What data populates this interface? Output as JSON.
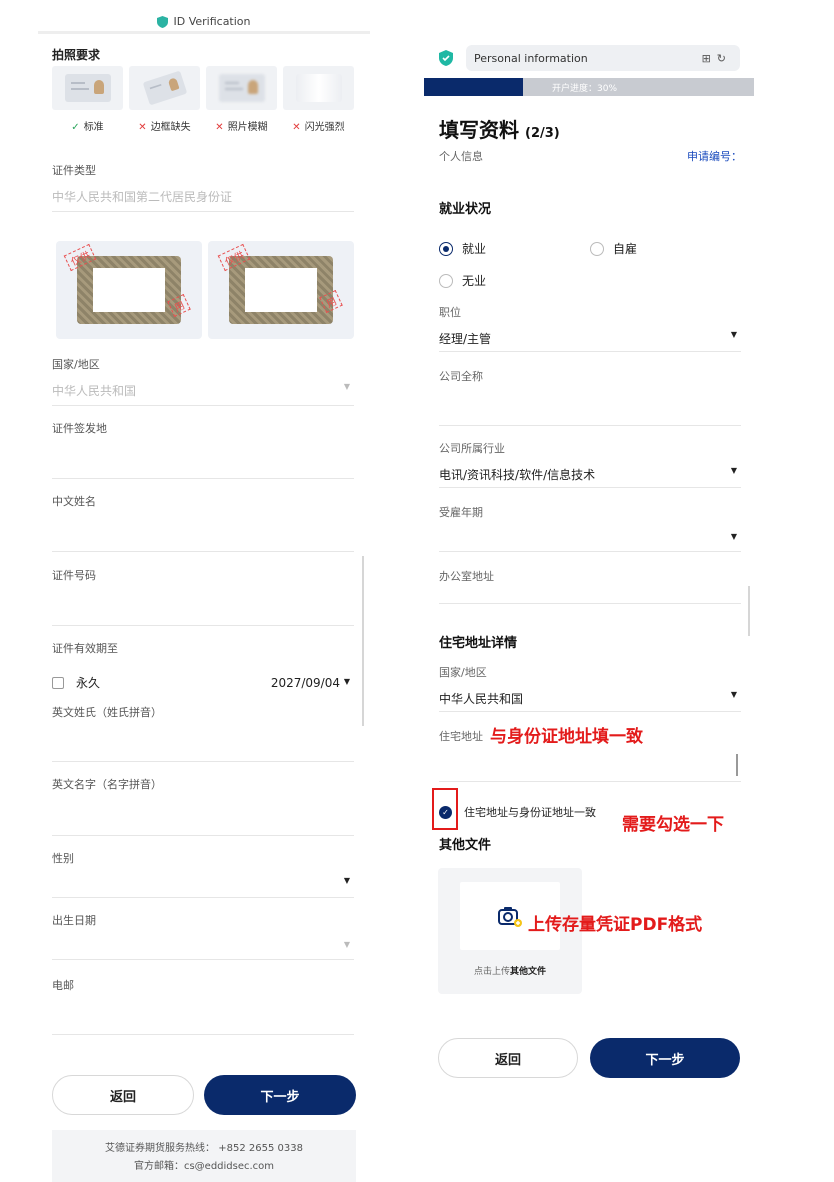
{
  "left": {
    "title_bar": "ID Verification",
    "photo_requirements_title": "拍照要求",
    "photo_requirements": [
      {
        "label": "标准",
        "status": "ok",
        "mark": "✓"
      },
      {
        "label": "边框缺失",
        "status": "bad",
        "mark": "✕"
      },
      {
        "label": "照片模糊",
        "status": "bad",
        "mark": "✕"
      },
      {
        "label": "闪光强烈",
        "status": "bad",
        "mark": "✕"
      }
    ],
    "doc_type": {
      "label": "证件类型",
      "value": "中华人民共和国第二代居民身份证"
    },
    "watermark_text": "仅供",
    "watermark_text2": "用",
    "country": {
      "label": "国家/地区",
      "value": "中华人民共和国"
    },
    "issue_place": {
      "label": "证件签发地"
    },
    "chinese_name": {
      "label": "中文姓名"
    },
    "id_number": {
      "label": "证件号码"
    },
    "expiry": {
      "label": "证件有效期至",
      "permanent_label": "永久",
      "date": "2027/09/04"
    },
    "en_surname": {
      "label": "英文姓氏（姓氏拼音）"
    },
    "en_given": {
      "label": "英文名字（名字拼音）"
    },
    "gender": {
      "label": "性别"
    },
    "birth_date": {
      "label": "出生日期"
    },
    "email": {
      "label": "电邮"
    },
    "back_button": "返回",
    "next_button": "下一步",
    "footer": {
      "hotline": "艾德证券期货服务热线： +852 2655 0338",
      "email": "官方邮箱：cs@eddidsec.com"
    }
  },
  "right": {
    "url_bar": "Personal information",
    "progress_text": "开户进度：30%",
    "progress": 0.3,
    "title": "填写资料",
    "step": "(2/3)",
    "subtitle": "个人信息",
    "app_no_label": "申请编号：",
    "employment_title": "就业状况",
    "employment_options": [
      {
        "label": "就业",
        "selected": true
      },
      {
        "label": "自雇",
        "selected": false
      },
      {
        "label": "无业",
        "selected": false
      }
    ],
    "position": {
      "label": "职位",
      "value": "经理/主管"
    },
    "company_name": {
      "label": "公司全称"
    },
    "industry": {
      "label": "公司所属行业",
      "value": "电讯/资讯科技/软件/信息技术"
    },
    "employ_years": {
      "label": "受雇年期"
    },
    "office_address": {
      "label": "办公室地址"
    },
    "residence_title": "住宅地址详情",
    "res_country": {
      "label": "国家/地区",
      "value": "中华人民共和国"
    },
    "res_address": {
      "label": "住宅地址"
    },
    "annotation_address": "与身份证地址填一致",
    "agree_text": "住宅地址与身份证地址一致",
    "annotation_check": "需要勾选一下",
    "other_docs_title": "其他文件",
    "upload_label_prefix": "点击上传",
    "upload_label_bold": "其他文件",
    "annotation_upload": "上传存量凭证PDF格式",
    "back_button": "返回",
    "next_button": "下一步"
  },
  "colors": {
    "primary": "#0a2a6b",
    "annotation_red": "#e31b1b",
    "ok_green": "#2aa55c"
  }
}
